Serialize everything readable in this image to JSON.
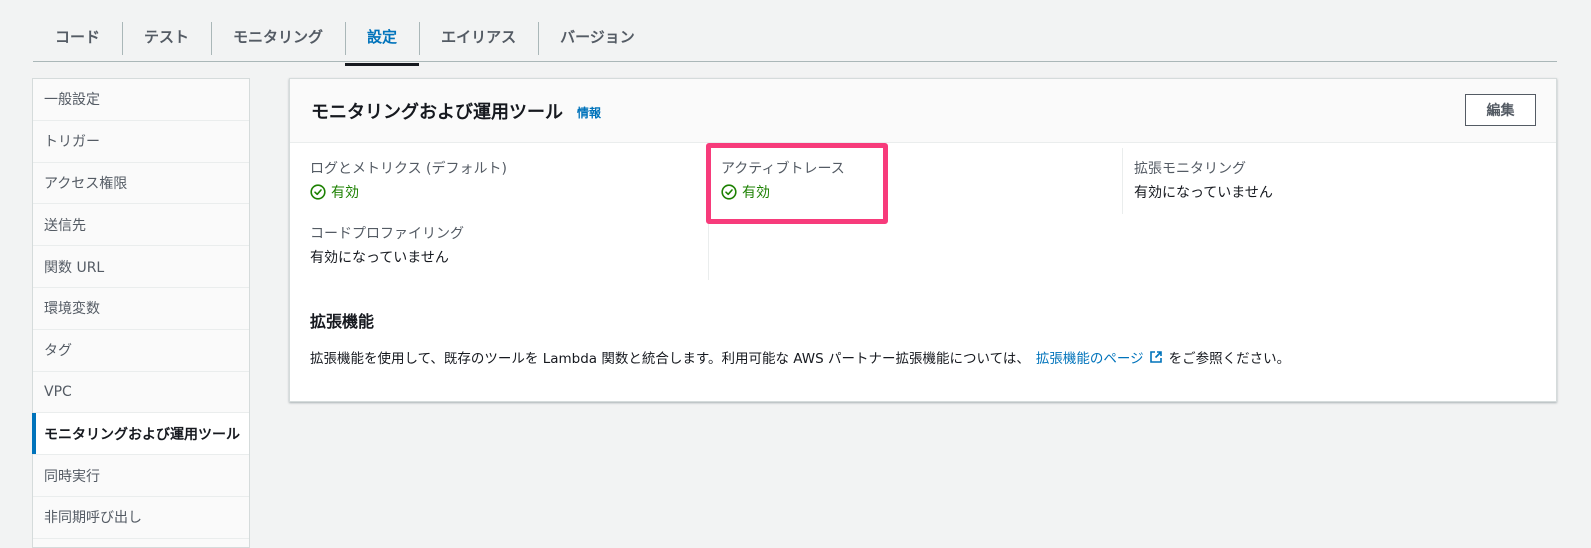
{
  "tabs": [
    {
      "label": "コード"
    },
    {
      "label": "テスト"
    },
    {
      "label": "モニタリング"
    },
    {
      "label": "設定"
    },
    {
      "label": "エイリアス"
    },
    {
      "label": "バージョン"
    }
  ],
  "sidebar": {
    "items": [
      {
        "label": "一般設定"
      },
      {
        "label": "トリガー"
      },
      {
        "label": "アクセス権限"
      },
      {
        "label": "送信先"
      },
      {
        "label": "関数 URL"
      },
      {
        "label": "環境変数"
      },
      {
        "label": "タグ"
      },
      {
        "label": "VPC"
      },
      {
        "label": "モニタリングおよび運用ツール"
      },
      {
        "label": "同時実行"
      },
      {
        "label": "非同期呼び出し"
      }
    ]
  },
  "panel": {
    "title": "モニタリングおよび運用ツール",
    "info": "情報",
    "edit_label": "編集",
    "logs_label": "ログとメトリクス (デフォルト)",
    "logs_value": "有効",
    "tracing_label": "アクティブトレース",
    "tracing_value": "有効",
    "enhanced_label": "拡張モニタリング",
    "enhanced_value": "有効になっていません",
    "profiling_label": "コードプロファイリング",
    "profiling_value": "有効になっていません",
    "extensions_title": "拡張機能",
    "extensions_text": "拡張機能を使用して、既存のツールを Lambda 関数と統合します。利用可能な AWS パートナー拡張機能については、",
    "extensions_link": "拡張機能のページ",
    "extensions_suffix": "をご参照ください。"
  },
  "colors": {
    "accent": "#0073bb",
    "success": "#1d8102",
    "highlight": "#f73b7b"
  }
}
